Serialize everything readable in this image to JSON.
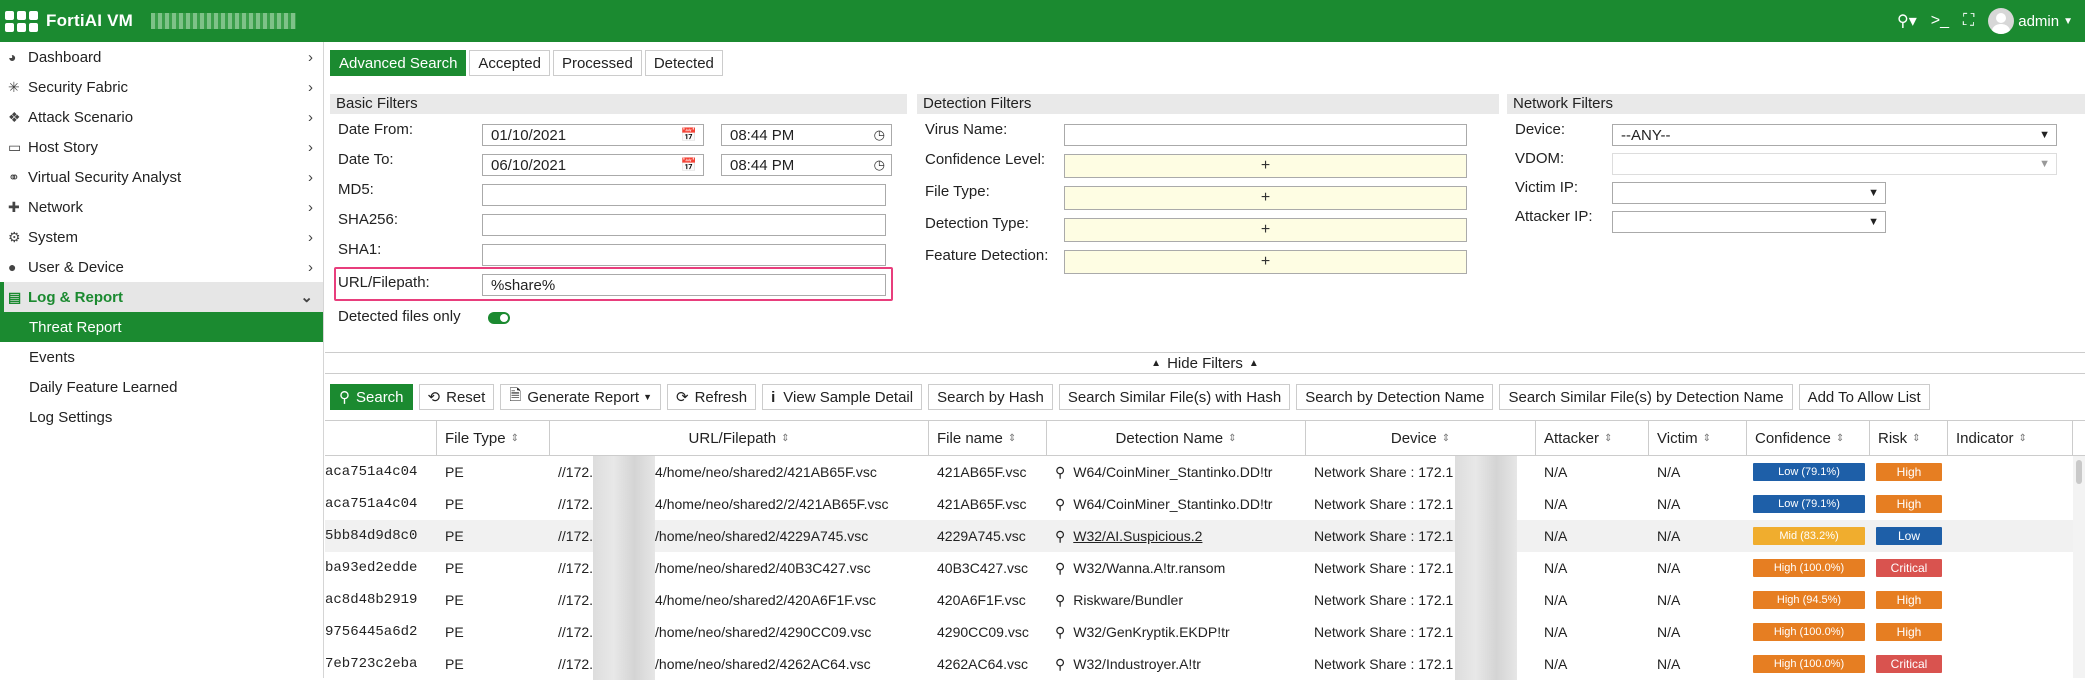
{
  "app": {
    "title": "FortiAI VM",
    "user": "admin"
  },
  "icons": {
    "search": "search-icon",
    "cli": "terminal-icon",
    "fullscreen": "fullscreen-icon"
  },
  "colors": {
    "brand": "#1b8a30",
    "highlight": "#e83e7c",
    "low": "#1e5fa8",
    "mid": "#f0ad2e",
    "high": "#e67e22",
    "critical": "#d9534f"
  },
  "sidebar": {
    "items": [
      {
        "label": "Dashboard",
        "icon": "dashboard-icon"
      },
      {
        "label": "Security Fabric",
        "icon": "fabric-icon"
      },
      {
        "label": "Attack Scenario",
        "icon": "scenario-icon"
      },
      {
        "label": "Host Story",
        "icon": "monitor-icon"
      },
      {
        "label": "Virtual Security Analyst",
        "icon": "analyst-icon"
      },
      {
        "label": "Network",
        "icon": "network-icon"
      },
      {
        "label": "System",
        "icon": "gear-icon"
      },
      {
        "label": "User & Device",
        "icon": "user-icon"
      },
      {
        "label": "Log & Report",
        "icon": "report-icon"
      }
    ],
    "subitems": [
      "Threat Report",
      "Events",
      "Daily Feature Learned",
      "Log Settings"
    ]
  },
  "tabs": [
    "Advanced Search",
    "Accepted",
    "Processed",
    "Detected"
  ],
  "basic": {
    "header": "Basic Filters",
    "date_from_label": "Date From:",
    "date_from": "01/10/2021",
    "time_from": "08:44 PM",
    "date_to_label": "Date To:",
    "date_to": "06/10/2021",
    "time_to": "08:44 PM",
    "md5_label": "MD5:",
    "sha256_label": "SHA256:",
    "sha1_label": "SHA1:",
    "url_label": "URL/Filepath:",
    "url_value": "%share%",
    "detected_only_label": "Detected files only"
  },
  "detection": {
    "header": "Detection Filters",
    "virus_label": "Virus Name:",
    "confidence_label": "Confidence Level:",
    "filetype_label": "File Type:",
    "dettype_label": "Detection Type:",
    "feature_label": "Feature Detection:",
    "plus": "+"
  },
  "network": {
    "header": "Network Filters",
    "device_label": "Device:",
    "device_value": "--ANY--",
    "vdom_label": "VDOM:",
    "victim_label": "Victim IP:",
    "attacker_label": "Attacker IP:"
  },
  "hide_filters": "Hide Filters",
  "actions": {
    "search": "Search",
    "reset": "Reset",
    "generate": "Generate Report",
    "refresh": "Refresh",
    "view": "View Sample Detail",
    "by_hash": "Search by Hash",
    "similar_hash": "Search Similar File(s) with Hash",
    "by_det": "Search by Detection Name",
    "similar_det": "Search Similar File(s) by Detection Name",
    "allow": "Add To Allow List"
  },
  "table": {
    "headers": [
      "File Type",
      "URL/Filepath",
      "File name",
      "Detection Name",
      "Device",
      "Attacker",
      "Victim",
      "Confidence",
      "Risk",
      "Indicator"
    ],
    "rows": [
      {
        "hash": "aca751a4c04",
        "type": "PE",
        "url_a": "//172.",
        "url_b": "4/home/neo/shared2/421AB65F.vsc",
        "file": "421AB65F.vsc",
        "det": "W64/CoinMiner_Stantinko.DD!tr",
        "device": "Network Share : 172.1",
        "attacker": "N/A",
        "victim": "N/A",
        "conf": "Low (79.1%)",
        "conf_level": "low",
        "risk": "High",
        "risk_level": "high"
      },
      {
        "hash": "aca751a4c04",
        "type": "PE",
        "url_a": "//172.",
        "url_b": "4/home/neo/shared2/2/421AB65F.vsc",
        "file": "421AB65F.vsc",
        "det": "W64/CoinMiner_Stantinko.DD!tr",
        "device": "Network Share : 172.1",
        "attacker": "N/A",
        "victim": "N/A",
        "conf": "Low (79.1%)",
        "conf_level": "low",
        "risk": "High",
        "risk_level": "high"
      },
      {
        "hash": "5bb84d9d8c0",
        "type": "PE",
        "url_a": "//172.",
        "url_b": "/home/neo/shared2/4229A745.vsc",
        "file": "4229A745.vsc",
        "det": "W32/AI.Suspicious.2",
        "device": "Network Share : 172.1",
        "attacker": "N/A",
        "victim": "N/A",
        "conf": "Mid (83.2%)",
        "conf_level": "mid",
        "risk": "Low",
        "risk_level": "low"
      },
      {
        "hash": "ba93ed2edde",
        "type": "PE",
        "url_a": "//172.",
        "url_b": "/home/neo/shared2/40B3C427.vsc",
        "file": "40B3C427.vsc",
        "det": "W32/Wanna.A!tr.ransom",
        "device": "Network Share : 172.1",
        "attacker": "N/A",
        "victim": "N/A",
        "conf": "High (100.0%)",
        "conf_level": "high",
        "risk": "Critical",
        "risk_level": "critical"
      },
      {
        "hash": "ac8d48b2919",
        "type": "PE",
        "url_a": "//172.",
        "url_b": "4/home/neo/shared2/420A6F1F.vsc",
        "file": "420A6F1F.vsc",
        "det": "Riskware/Bundler",
        "device": "Network Share : 172.1",
        "attacker": "N/A",
        "victim": "N/A",
        "conf": "High (94.5%)",
        "conf_level": "high",
        "risk": "High",
        "risk_level": "high"
      },
      {
        "hash": "9756445a6d2",
        "type": "PE",
        "url_a": "//172.",
        "url_b": "/home/neo/shared2/4290CC09.vsc",
        "file": "4290CC09.vsc",
        "det": "W32/GenKryptik.EKDP!tr",
        "device": "Network Share : 172.1",
        "attacker": "N/A",
        "victim": "N/A",
        "conf": "High (100.0%)",
        "conf_level": "high",
        "risk": "High",
        "risk_level": "high"
      },
      {
        "hash": "7eb723c2eba",
        "type": "PE",
        "url_a": "//172.",
        "url_b": "/home/neo/shared2/4262AC64.vsc",
        "file": "4262AC64.vsc",
        "det": "W32/Industroyer.A!tr",
        "device": "Network Share : 172.1",
        "attacker": "N/A",
        "victim": "N/A",
        "conf": "High (100.0%)",
        "conf_level": "high",
        "risk": "Critical",
        "risk_level": "critical"
      }
    ]
  }
}
